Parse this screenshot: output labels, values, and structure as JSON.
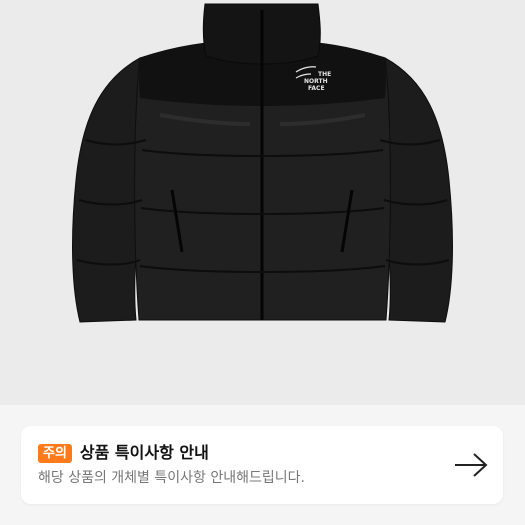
{
  "notice": {
    "badge": "주의",
    "title": "상품 특이사항 안내",
    "subtitle": "해당 상품의 개체별 특이사항 안내해드립니다."
  },
  "product_image": {
    "logo_lines": [
      "THE",
      "NORTH",
      "FACE"
    ],
    "item": "black puffer jacket"
  },
  "icons": {
    "notice_arrow": "arrow-right-icon"
  },
  "colors": {
    "badge_bg": "#ff7a1a",
    "image_bg": "#ebebec",
    "page_bg": "#f5f5f6",
    "card_bg": "#ffffff"
  }
}
